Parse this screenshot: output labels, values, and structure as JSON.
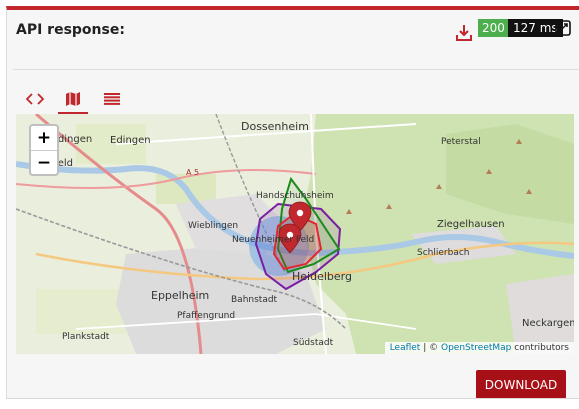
{
  "header": {
    "title": "API response:",
    "status_code": "200",
    "duration": "127 ms"
  },
  "tabs": [
    {
      "name": "code-icon",
      "active": false
    },
    {
      "name": "map-icon",
      "active": true
    },
    {
      "name": "list-icon",
      "active": false
    }
  ],
  "map": {
    "zoom_in": "+",
    "zoom_out": "−",
    "places": [
      "Dossenheim",
      "Edingen",
      "-Edingen",
      "sfeld",
      "Handschuhsheim",
      "Wieblingen",
      "Neuenheimer Feld",
      "Heidelberg",
      "Eppelheim",
      "Pfaffengrund",
      "Bahnstadt",
      "Plankstadt",
      "Südstadt",
      "Peterstal",
      "Ziegelhausen",
      "Schlierbach",
      "Neckargem",
      "A 5"
    ],
    "attribution": {
      "leaflet": "Leaflet",
      "separator": "| ©",
      "osm": "OpenStreetMap",
      "suffix": "contributors"
    },
    "colors": {
      "green": "#1a8a1a",
      "purple": "#7a1fa2",
      "red": "#e0282e",
      "blue": "#5aa2e6"
    }
  },
  "actions": {
    "download_label": "DOWNLOAD"
  }
}
